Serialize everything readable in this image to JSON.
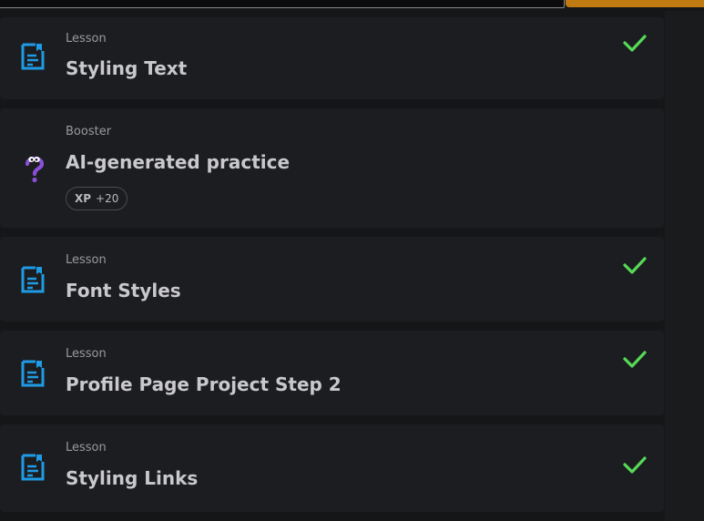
{
  "items": [
    {
      "kind": "Lesson",
      "title": "Styling Text",
      "icon": "lesson-doc-icon",
      "completed": true
    },
    {
      "kind": "Booster",
      "title": "AI-generated practice",
      "icon": "question-mascot-icon",
      "xp_label": "XP",
      "xp_value": "+20",
      "completed": false
    },
    {
      "kind": "Lesson",
      "title": "Font Styles",
      "icon": "lesson-doc-icon",
      "completed": true
    },
    {
      "kind": "Lesson",
      "title": "Profile Page Project Step 2",
      "icon": "lesson-doc-icon",
      "completed": true
    },
    {
      "kind": "Lesson",
      "title": "Styling Links",
      "icon": "lesson-doc-icon",
      "completed": true
    }
  ],
  "colors": {
    "accent_blue": "#1f9be6",
    "check_green": "#57d957",
    "booster_purple": "#8a4fd8",
    "top_button": "#c07a12"
  }
}
